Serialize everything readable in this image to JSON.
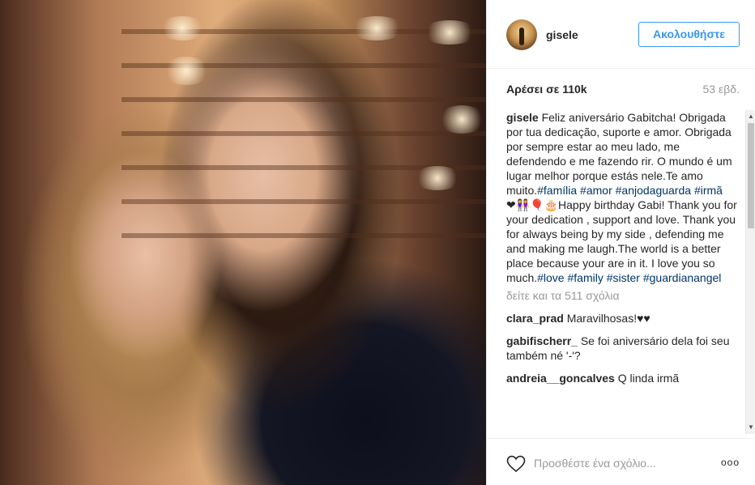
{
  "post": {
    "username": "gisele",
    "follow_label": "Ακολουθήστε",
    "likes": "Αρέσει σε 110k",
    "age": "53 εβδ.",
    "caption": {
      "username": "gisele",
      "text_pt": " Feliz aniversário Gabitcha! Obrigada por tua dedicação, suporte e amor. Obrigada por sempre estar ao meu lado, me defendendo e me fazendo rir. O mundo é um lugar melhor porque estás nele.Te amo muito.",
      "tags_pt": [
        "#família",
        "#amor",
        "#anjodaguarda",
        "#irmã"
      ],
      "emojis": "❤👭🎈🎂",
      "text_en": "Happy birthday Gabi! Thank you for your dedication , support and love. Thank you for always being by my side , defending me and making me laugh.The world is a better place because your are in it. I love you so much.",
      "tags_en": [
        "#love",
        "#family",
        "#sister",
        "#guardianangel"
      ]
    },
    "view_all": "δείτε και τα 511 σχόλια",
    "comments": [
      {
        "user": "clara_prad",
        "text": " Maravilhosas!♥♥"
      },
      {
        "user": "gabifischerr_",
        "text": " Se foi aniversário dela foi seu também né '-'?"
      },
      {
        "user": "andreia__goncalves",
        "text": " Q linda irmã"
      }
    ],
    "add_comment_placeholder": "Προσθέστε ένα σχόλιο...",
    "more_label": "ooo"
  },
  "icons": {
    "heart": "heart-icon",
    "more": "more-options-icon",
    "scroll_up": "scroll-up-arrow-icon",
    "scroll_down": "scroll-down-arrow-icon"
  },
  "colors": {
    "accent": "#3897f0",
    "hashtag": "#003569",
    "muted": "#999999"
  }
}
